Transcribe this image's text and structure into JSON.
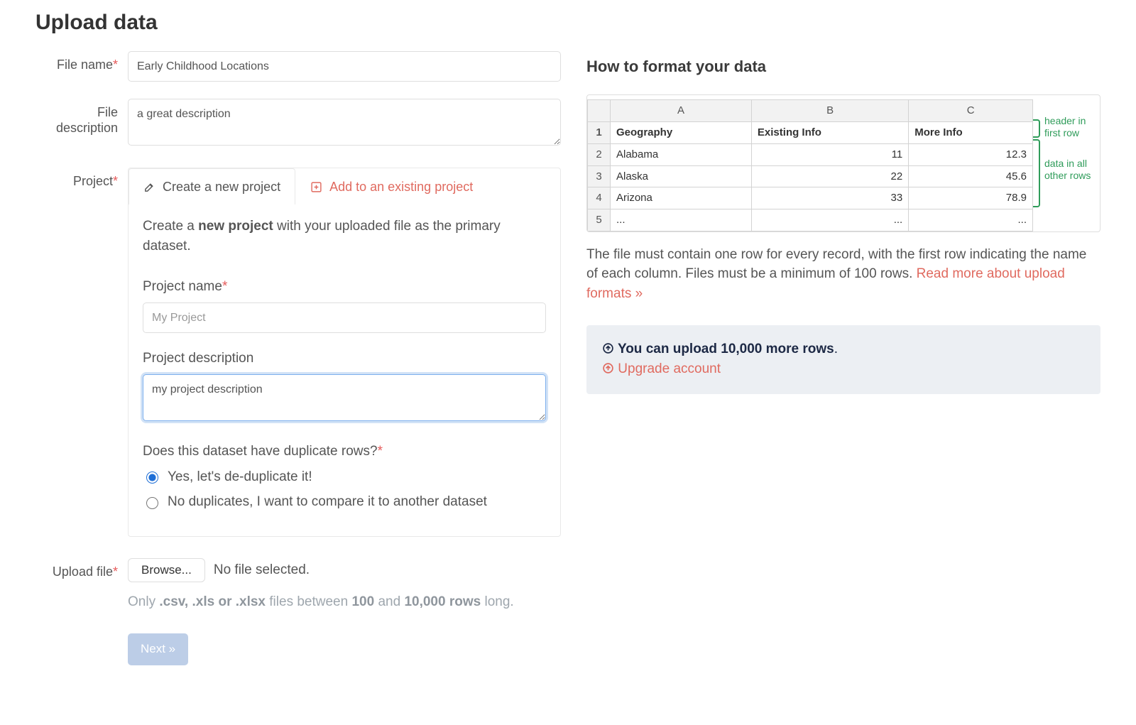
{
  "page_title": "Upload data",
  "form": {
    "file_name": {
      "label": "File name",
      "value": "Early Childhood Locations"
    },
    "file_description": {
      "label": "File description",
      "value": "a great description"
    },
    "project_label": "Project",
    "tabs": {
      "create": {
        "label": "Create a new project"
      },
      "existing": {
        "label": "Add to an existing project"
      }
    },
    "create_pane": {
      "lead_pre": "Create a ",
      "lead_strong": "new project",
      "lead_post": " with your uploaded file as the primary dataset.",
      "project_name": {
        "label": "Project name",
        "placeholder": "My Project",
        "value": ""
      },
      "project_description": {
        "label": "Project description",
        "value": "my project description"
      },
      "dedupe": {
        "question": "Does this dataset have duplicate rows?",
        "yes": "Yes, let's de-duplicate it!",
        "no": "No duplicates, I want to compare it to another dataset"
      }
    },
    "upload": {
      "label": "Upload file",
      "browse": "Browse...",
      "status": "No file selected.",
      "hint_pre": "Only ",
      "hint_exts": ".csv, .xls or .xlsx",
      "hint_mid1": " files between ",
      "hint_min": "100",
      "hint_mid2": " and ",
      "hint_max": "10,000 rows",
      "hint_post": " long."
    },
    "next": "Next »"
  },
  "sidebar": {
    "title": "How to format your data",
    "sheet": {
      "cols": [
        "A",
        "B",
        "C"
      ],
      "header": [
        "Geography",
        "Existing Info",
        "More Info"
      ],
      "rows": [
        {
          "n": "2",
          "c": [
            "Alabama",
            "11",
            "12.3"
          ]
        },
        {
          "n": "3",
          "c": [
            "Alaska",
            "22",
            "45.6"
          ]
        },
        {
          "n": "4",
          "c": [
            "Arizona",
            "33",
            "78.9"
          ]
        },
        {
          "n": "5",
          "c": [
            "...",
            "...",
            "..."
          ]
        }
      ],
      "annot_header": "header in first row",
      "annot_data": "data in all other rows"
    },
    "paragraph": "The file must contain one row for every record, with the first row indicating the name of each column. Files must be a minimum of 100 rows. ",
    "link_text": "Read more about upload formats »",
    "well": {
      "line1_pre": "You can upload ",
      "line1_strong": "10,000 more rows",
      "line1_post": ".",
      "line2": "Upgrade account"
    }
  }
}
